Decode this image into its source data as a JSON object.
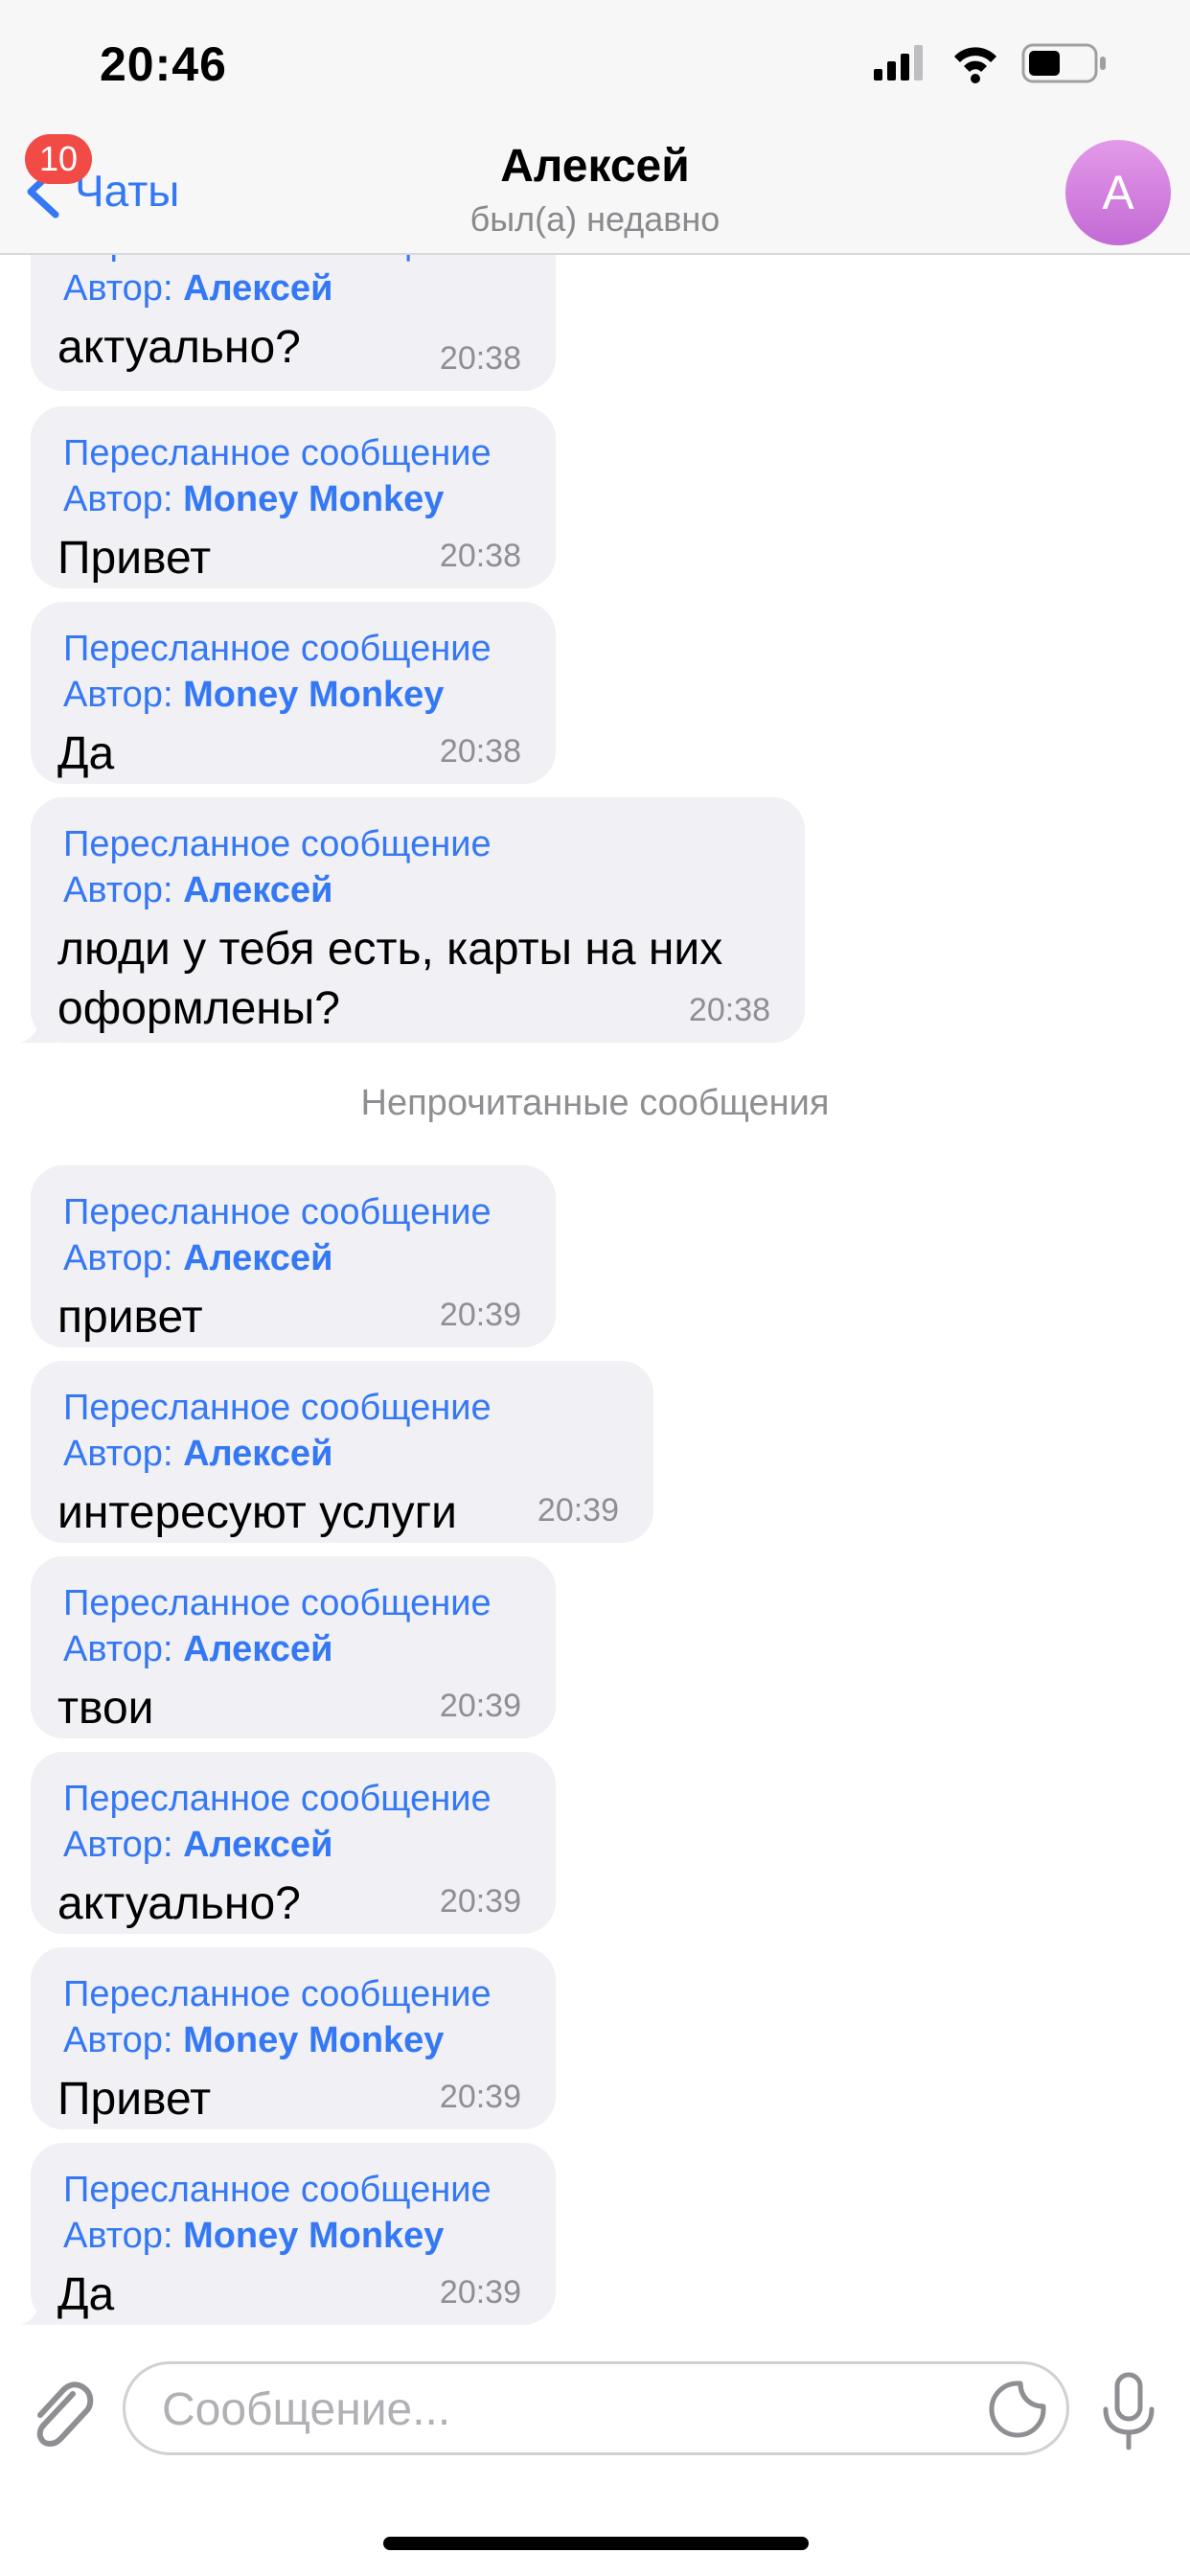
{
  "status_bar": {
    "time": "20:46"
  },
  "header": {
    "back_label": "Чаты",
    "unread_count": "10",
    "title": "Алексей",
    "subtitle": "был(а) недавно",
    "avatar_letter": "А"
  },
  "messages_before": [
    {
      "fwd_label": "Пересланное сообщение",
      "author_prefix": "Автор: ",
      "author": "Алексей",
      "text": "актуально?",
      "time": "20:38"
    },
    {
      "fwd_label": "Пересланное сообщение",
      "author_prefix": "Автор: ",
      "author": "Money Monkey",
      "text": "Привет",
      "time": "20:38"
    },
    {
      "fwd_label": "Пересланное сообщение",
      "author_prefix": "Автор: ",
      "author": "Money Monkey",
      "text": "Да",
      "time": "20:38"
    },
    {
      "fwd_label": "Пересланное сообщение",
      "author_prefix": "Автор: ",
      "author": "Алексей",
      "text": "люди у тебя есть, карты на них оформлены?",
      "time": "20:38"
    }
  ],
  "unread_divider": "Непрочитанные сообщения",
  "messages_after": [
    {
      "fwd_label": "Пересланное сообщение",
      "author_prefix": "Автор: ",
      "author": "Алексей",
      "text": "привет",
      "time": "20:39"
    },
    {
      "fwd_label": "Пересланное сообщение",
      "author_prefix": "Автор: ",
      "author": "Алексей",
      "text": "интересуют услуги",
      "time": "20:39"
    },
    {
      "fwd_label": "Пересланное сообщение",
      "author_prefix": "Автор: ",
      "author": "Алексей",
      "text": "твои",
      "time": "20:39"
    },
    {
      "fwd_label": "Пересланное сообщение",
      "author_prefix": "Автор: ",
      "author": "Алексей",
      "text": "актуально?",
      "time": "20:39"
    },
    {
      "fwd_label": "Пересланное сообщение",
      "author_prefix": "Автор: ",
      "author": "Money Monkey",
      "text": "Привет",
      "time": "20:39"
    },
    {
      "fwd_label": "Пересланное сообщение",
      "author_prefix": "Автор: ",
      "author": "Money Monkey",
      "text": "Да",
      "time": "20:39"
    }
  ],
  "input": {
    "placeholder": "Сообщение..."
  },
  "colors": {
    "accent": "#3478f6",
    "bubble": "#f0f0f5",
    "badge": "#f24b46",
    "avatar": "#c36ad5"
  },
  "icons": [
    "signal-icon",
    "wifi-icon",
    "battery-icon",
    "back-chevron-icon",
    "attach-icon",
    "sticker-icon",
    "microphone-icon"
  ]
}
